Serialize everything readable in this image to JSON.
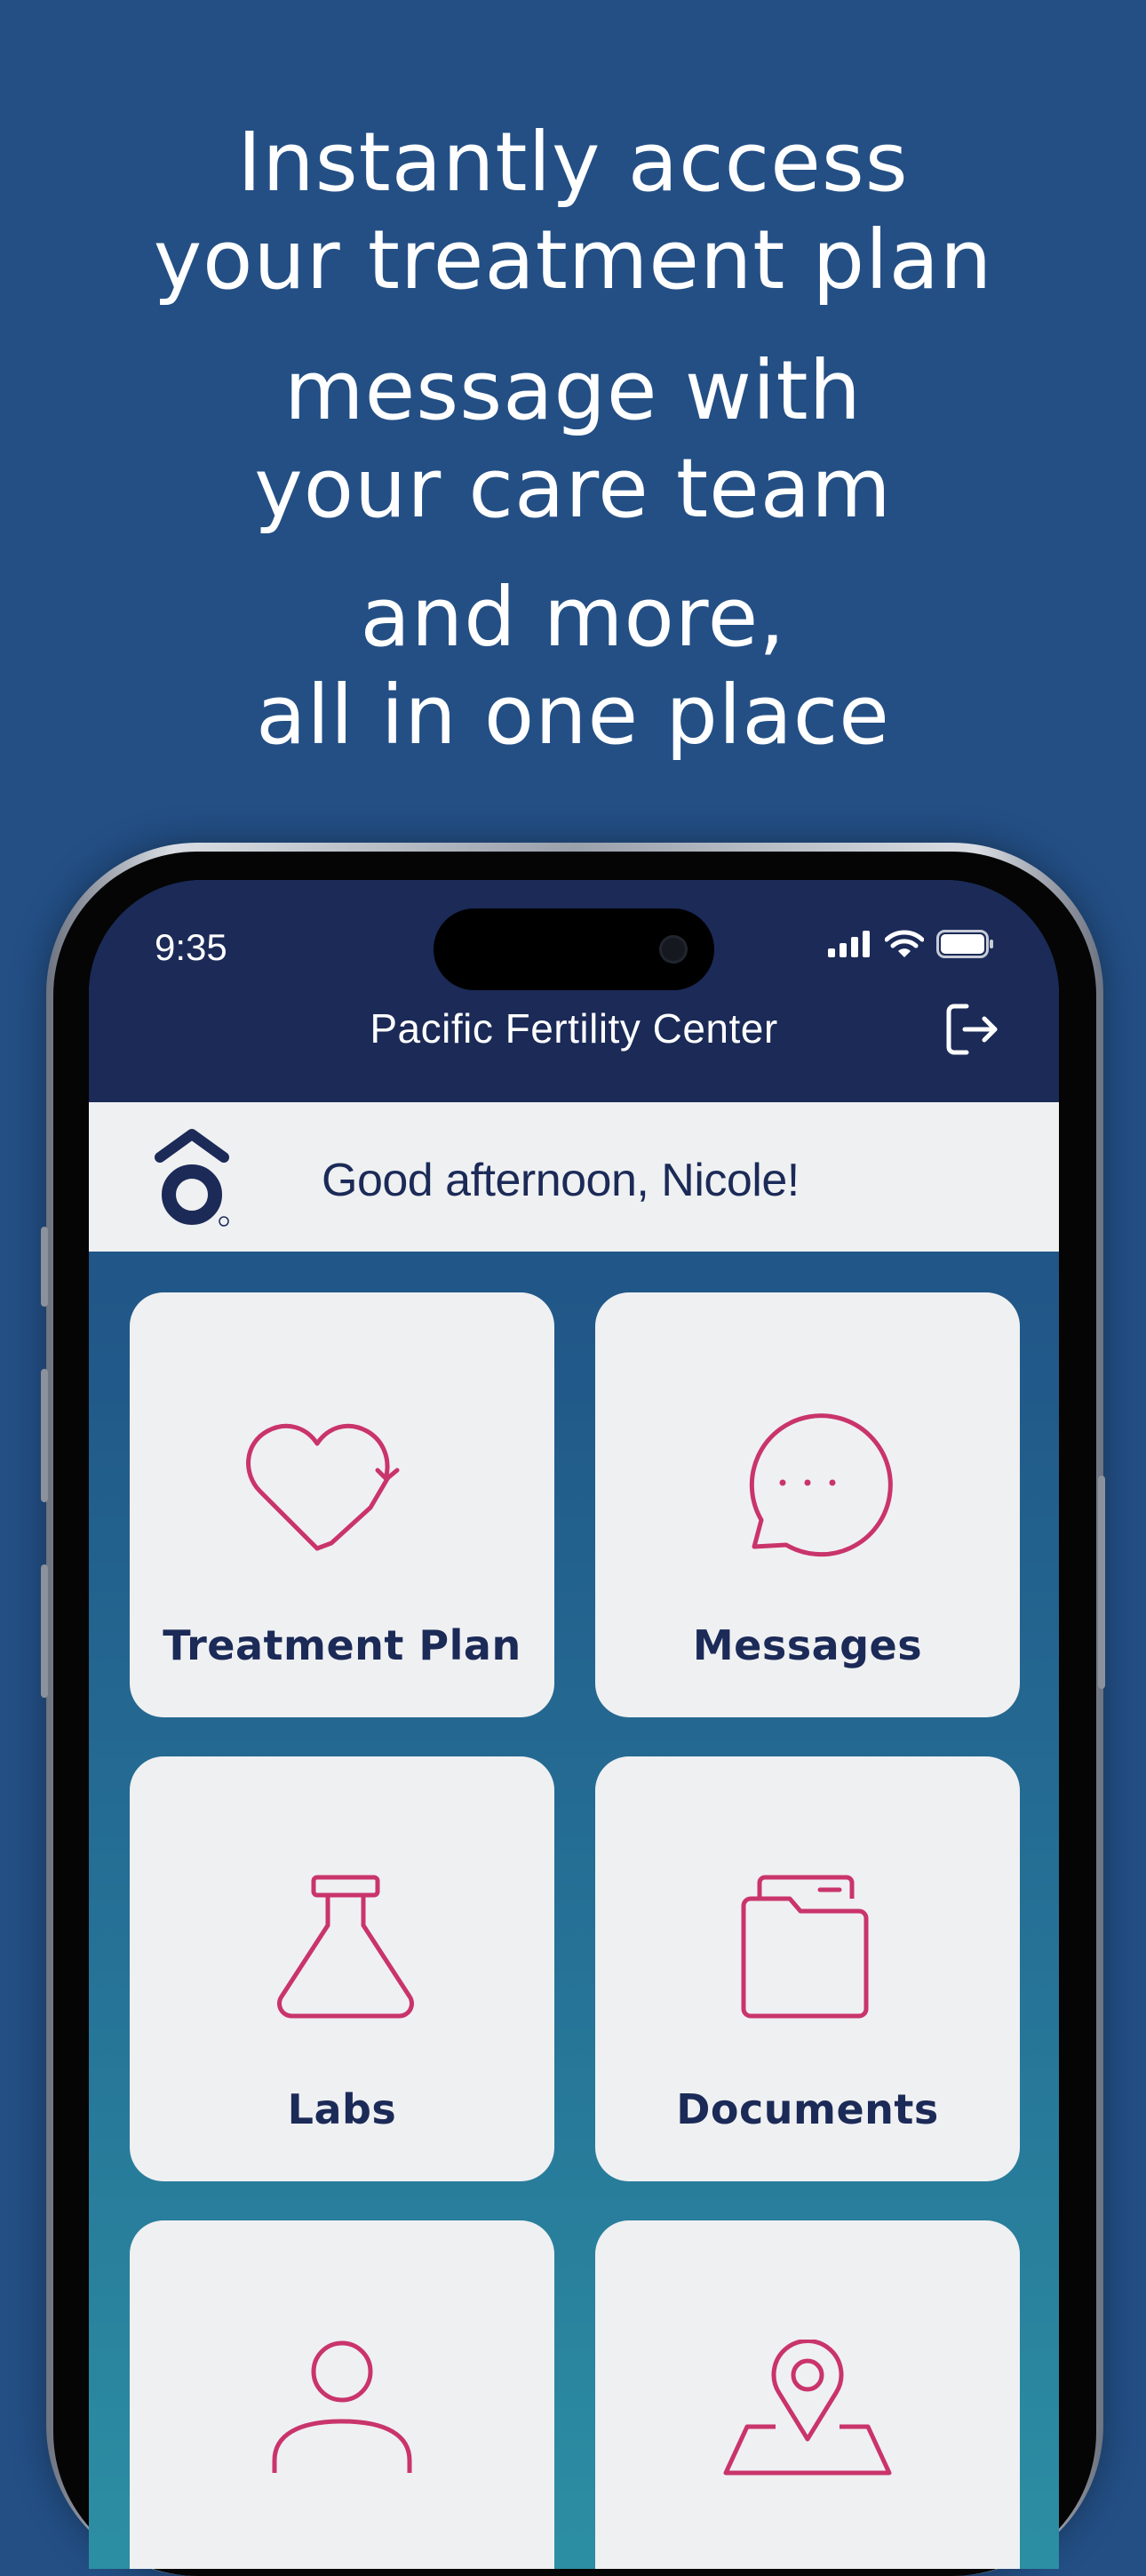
{
  "promo": {
    "headline": [
      {
        "line1": "Instantly access",
        "line2": "your treatment plan"
      },
      {
        "line1": "message with",
        "line2": "your care team"
      },
      {
        "line1": "and more,",
        "line2": "all in one place"
      }
    ]
  },
  "status_bar": {
    "time": "9:35"
  },
  "header": {
    "title": "Pacific Fertility Center",
    "logout_icon": "logout-icon"
  },
  "greeting": {
    "text": "Good afternoon, Nicole!",
    "logo_icon": "brand-logo"
  },
  "tiles": [
    {
      "label": "Treatment Plan",
      "icon": "heart-arrow-icon"
    },
    {
      "label": "Messages",
      "icon": "chat-bubble-icon"
    },
    {
      "label": "Labs",
      "icon": "flask-icon"
    },
    {
      "label": "Documents",
      "icon": "folder-icon"
    },
    {
      "label": "",
      "icon": "person-icon"
    },
    {
      "label": "",
      "icon": "location-map-icon"
    }
  ],
  "colors": {
    "background": "#234f85",
    "header": "#1b2a57",
    "tile": "#eff0f2",
    "accent": "#c9346b",
    "text_dark": "#1b2a57"
  }
}
